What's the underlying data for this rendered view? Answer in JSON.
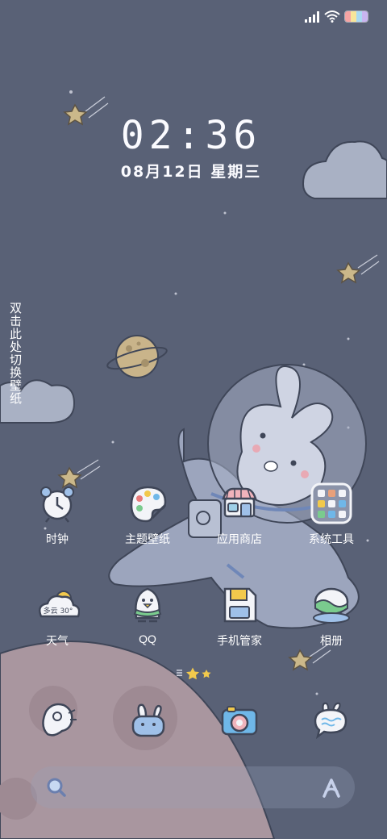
{
  "status_bar": {
    "icons": [
      "signal-icon",
      "wifi-icon",
      "battery-icon"
    ],
    "battery_colors": [
      "#f6a4a4",
      "#f7e59a",
      "#a9d9f2",
      "#c9b4f0"
    ]
  },
  "lock": {
    "time": "02:36",
    "date": "08月12日 星期三"
  },
  "wallpaper_hint": "双击此处切换壁纸",
  "apps_row1": [
    {
      "label": "时钟",
      "icon": "alarm-clock-icon"
    },
    {
      "label": "主题壁纸",
      "icon": "palette-icon"
    },
    {
      "label": "应用商店",
      "icon": "shop-icon"
    },
    {
      "label": "系统工具",
      "icon": "folder-icon"
    }
  ],
  "apps_row2": [
    {
      "label": "天气",
      "icon": "weather-icon",
      "badge": "多云 30°"
    },
    {
      "label": "QQ",
      "icon": "penguin-icon"
    },
    {
      "label": "手机管家",
      "icon": "floppy-icon"
    },
    {
      "label": "相册",
      "icon": "gallery-icon"
    }
  ],
  "dock": [
    {
      "icon": "phone-icon"
    },
    {
      "icon": "bunny-messages-icon"
    },
    {
      "icon": "camera-icon"
    },
    {
      "icon": "chat-bubble-icon"
    }
  ],
  "pager": {
    "pages": 3,
    "active": 1
  },
  "search": {
    "icons": [
      "search-icon",
      "assistant-icon"
    ]
  },
  "colors": {
    "background": "#596176",
    "planet": "#a9969f",
    "cloud": "#a9b1c4"
  }
}
